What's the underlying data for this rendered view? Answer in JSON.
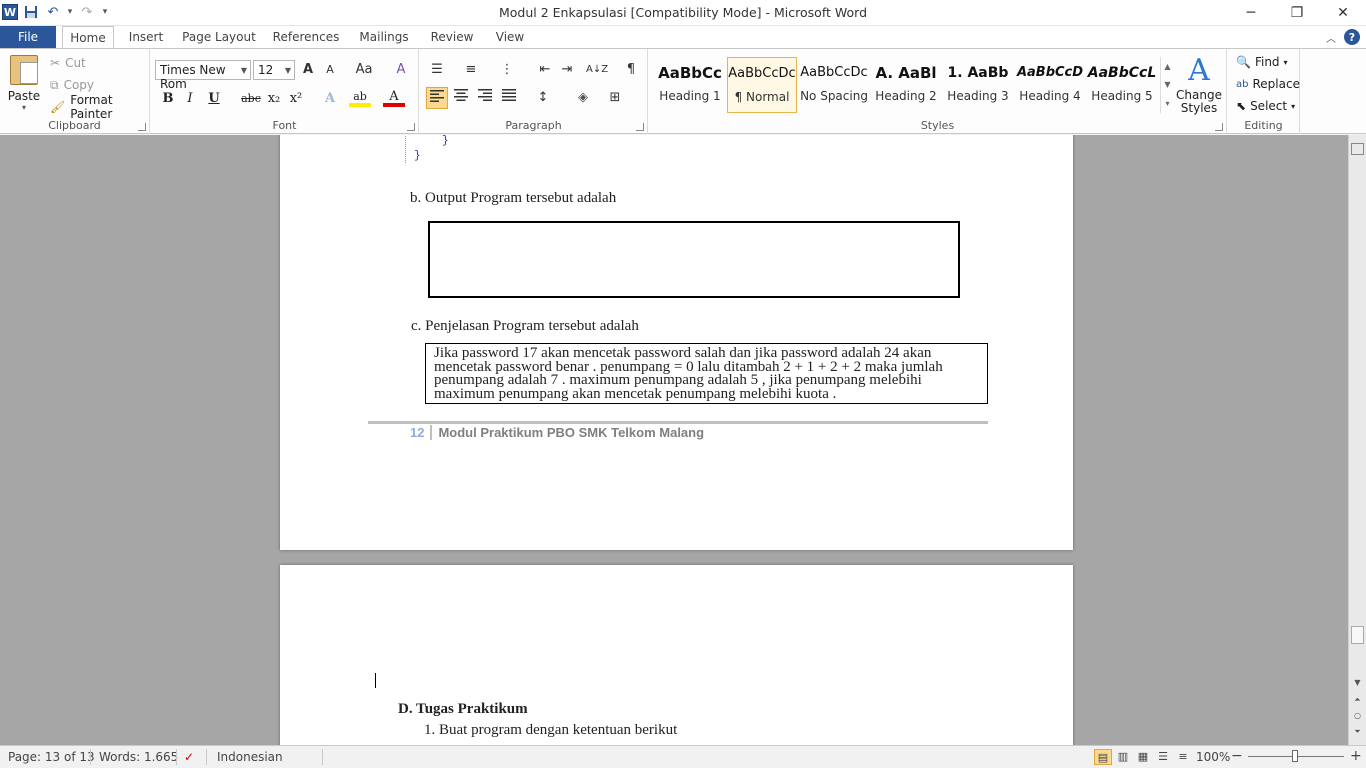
{
  "window": {
    "title": "Modul 2 Enkapsulasi [Compatibility Mode]  -  Microsoft Word",
    "minimize": "─",
    "restore": "❐",
    "close": "✕"
  },
  "qat": {
    "app_icon": "W",
    "save": "💾",
    "undo": "↶",
    "redo": "↷",
    "customize": "▾"
  },
  "tabs": [
    "File",
    "Home",
    "Insert",
    "Page Layout",
    "References",
    "Mailings",
    "Review",
    "View"
  ],
  "active_tab": "Home",
  "ribbon": {
    "clipboard": {
      "label": "Clipboard",
      "paste": "Paste",
      "cut": "Cut",
      "copy": "Copy",
      "format_painter": "Format Painter"
    },
    "font": {
      "label": "Font",
      "family": "Times New Rom",
      "size": "12",
      "grow": "A",
      "shrink": "A",
      "case": "Aa",
      "clear": "A",
      "bold": "B",
      "italic": "I",
      "underline": "U",
      "strike": "abc",
      "subscript": "x₂",
      "superscript": "x²",
      "effects": "A",
      "highlight": "ab",
      "color": "A"
    },
    "paragraph": {
      "label": "Paragraph",
      "show_marks": "¶",
      "sort": "A↓Z"
    },
    "styles": {
      "label": "Styles",
      "items": [
        {
          "preview": "AaBbCc",
          "name": "Heading 1"
        },
        {
          "preview": "AaBbCcDc",
          "name": "¶ Normal"
        },
        {
          "preview": "AaBbCcDc",
          "name": "No Spacing"
        },
        {
          "preview": "A.  AaBl",
          "name": "Heading 2"
        },
        {
          "preview": "1.  AaBb",
          "name": "Heading 3"
        },
        {
          "preview": "AaBbCcD",
          "name": "Heading 4"
        },
        {
          "preview": "AaBbCcL",
          "name": "Heading 5"
        }
      ],
      "change_styles": "Change Styles",
      "change_icon": "A"
    },
    "editing": {
      "label": "Editing",
      "find": "Find",
      "replace": "Replace",
      "select": "Select"
    }
  },
  "document": {
    "code_brace_inner": "}",
    "code_brace_outer": "}",
    "item_b": "b.   Output Program tersebut adalah",
    "item_c": "c. Penjelasan  Program  tersebut adalah",
    "explanation_lines": [
      "Jika  password 17 akan mencetak password salah  dan jika password adalah 24 akan",
      "mencetak password benar . penumpang = 0 lalu ditambah 2 + 1 + 2 + 2 maka jumlah",
      "penumpang  adalah 7 . maximum  penumpang  adalah 5 , jika penumpang  melebihi",
      "maximum  penumpang  akan mencetak penumpang  melebihi  kuota ."
    ],
    "footer_page": "12",
    "footer_text": "Modul Praktikum PBO SMK Telkom Malang",
    "heading_d": "D.   Tugas Praktikum",
    "item_1": "1.   Buat program dengan ketentuan berikut"
  },
  "statusbar": {
    "page": "Page: 13 of 13",
    "words": "Words: 1.665",
    "language": "Indonesian",
    "zoom": "100%",
    "zoom_minus": "−",
    "zoom_plus": "+",
    "zoom_level": 1.0
  },
  "colors": {
    "accent": "#2b579a",
    "selected": "#fcd991",
    "page_bg": "#a6a6a6"
  }
}
